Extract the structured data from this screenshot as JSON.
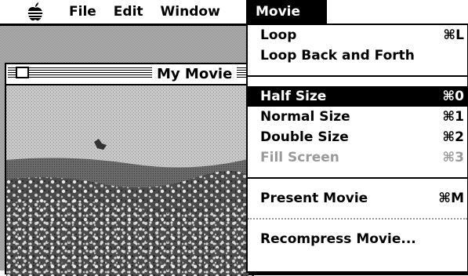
{
  "menubar": {
    "apple_icon": "apple-logo-icon",
    "menus": [
      "File",
      "Edit",
      "Window"
    ],
    "open_menu": "Movie"
  },
  "window": {
    "title": "My Movie",
    "close_icon": "close-box-icon",
    "content": "flower-field-video-frame"
  },
  "movie_menu": {
    "items": [
      {
        "label": "Loop",
        "shortcut": "⌘L"
      },
      {
        "label": "Loop Back and Forth",
        "shortcut": ""
      },
      {
        "label": "Half Size",
        "shortcut": "⌘0"
      },
      {
        "label": "Normal Size",
        "shortcut": "⌘1"
      },
      {
        "label": "Double Size",
        "shortcut": "⌘2"
      },
      {
        "label": "Fill Screen",
        "shortcut": "⌘3"
      },
      {
        "label": "Present Movie",
        "shortcut": "⌘M"
      },
      {
        "label": "Recompress Movie...",
        "shortcut": ""
      }
    ]
  },
  "colors": {
    "highlight": "#000000",
    "disabled": "#9a9a9a",
    "desktop": "#8a8a8a"
  }
}
